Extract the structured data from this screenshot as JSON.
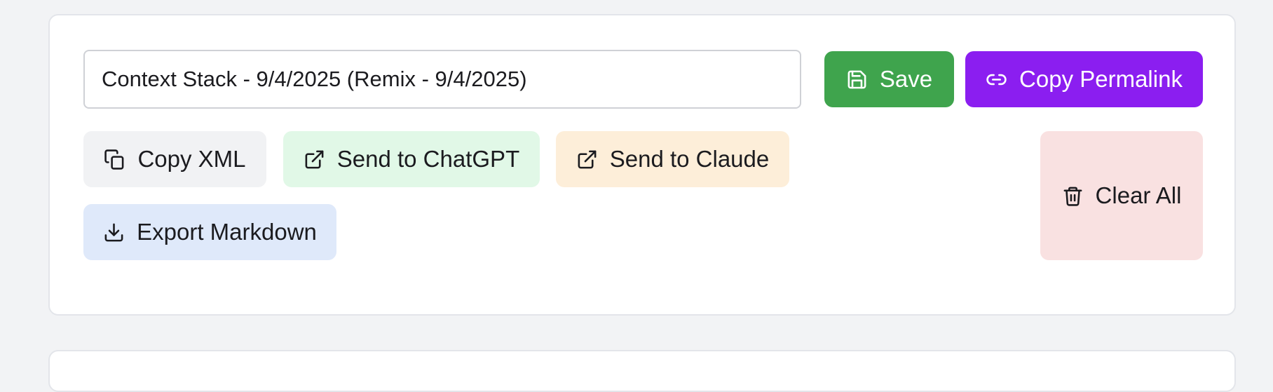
{
  "editor": {
    "title_value": "Context Stack - 9/4/2025 (Remix - 9/4/2025)"
  },
  "actions": {
    "save": {
      "label": "Save",
      "icon": "save-icon",
      "color": "#3fa44d"
    },
    "copy_permalink": {
      "label": "Copy Permalink",
      "icon": "link-icon",
      "color": "#8b1ef0"
    },
    "copy_xml": {
      "label": "Copy XML",
      "icon": "copy-icon",
      "color": "#f1f2f4"
    },
    "send_chatgpt": {
      "label": "Send to ChatGPT",
      "icon": "external-link-icon",
      "color": "#e1f8e7"
    },
    "send_claude": {
      "label": "Send to Claude",
      "icon": "external-link-icon",
      "color": "#fdeed9"
    },
    "export_markdown": {
      "label": "Export Markdown",
      "icon": "download-icon",
      "color": "#dfe9fa"
    },
    "clear_all": {
      "label": "Clear All",
      "icon": "trash-icon",
      "color": "#f9e1e1"
    }
  }
}
